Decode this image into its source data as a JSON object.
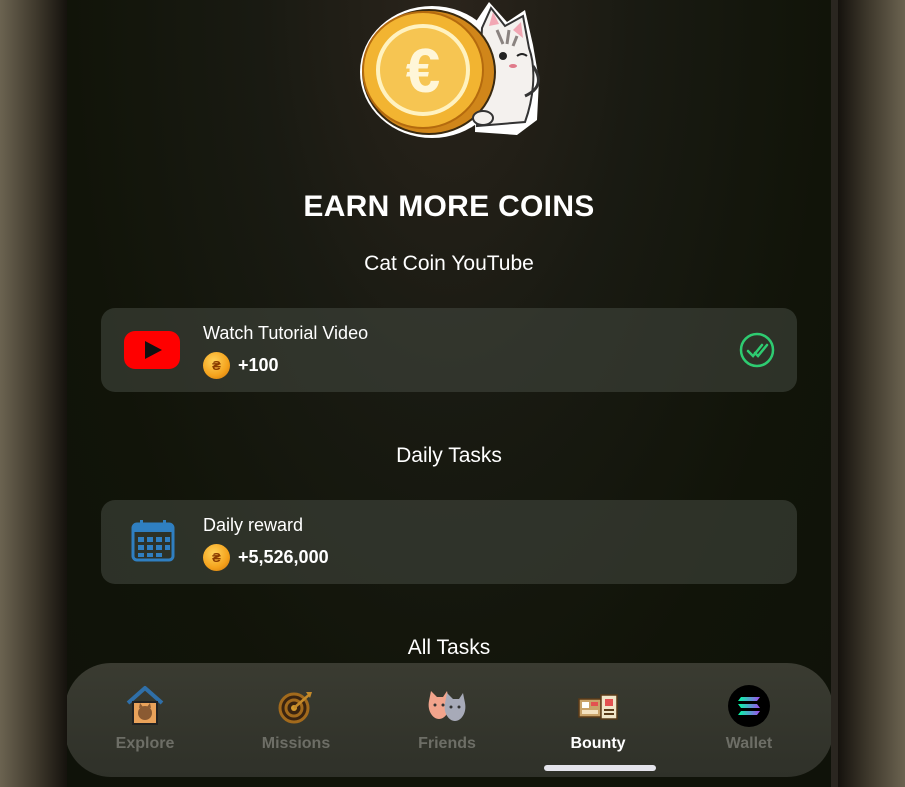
{
  "page": {
    "title": "EARN MORE COINS"
  },
  "sections": {
    "youtube_title": "Cat Coin YouTube",
    "daily_title": "Daily Tasks",
    "all_title": "All Tasks"
  },
  "tasks": {
    "youtube": {
      "name": "Watch Tutorial Video",
      "reward": "+100",
      "icon": "youtube-icon",
      "status": "completed"
    },
    "daily": {
      "name": "Daily reward",
      "reward": "+5,526,000",
      "icon": "calendar-icon"
    }
  },
  "nav": {
    "items": [
      {
        "label": "Explore",
        "icon": "cat-house-icon",
        "active": false
      },
      {
        "label": "Missions",
        "icon": "target-icon",
        "active": false
      },
      {
        "label": "Friends",
        "icon": "cats-friends-icon",
        "active": false
      },
      {
        "label": "Bounty",
        "icon": "bounty-board-icon",
        "active": true
      },
      {
        "label": "Wallet",
        "icon": "solana-icon",
        "active": false
      }
    ]
  },
  "colors": {
    "accent_check": "#2ecc71",
    "youtube_red": "#ff0000",
    "calendar_blue": "#2f7fc1",
    "coin_gold": "#f4a21c"
  }
}
